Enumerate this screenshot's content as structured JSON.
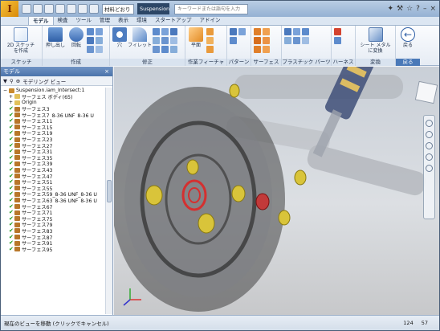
{
  "titlebar": {
    "material": "材料どおり",
    "document": "Suspension...",
    "search_placeholder": "キーワードまたは語句を入力"
  },
  "tabs": [
    "モデル",
    "検査",
    "ツール",
    "管理",
    "表示",
    "環境",
    "スタートアップ",
    "アドイン"
  ],
  "ribbon": {
    "sketch": {
      "create_2d": "2D スケッチ\nを作成",
      "label": "スケッチ"
    },
    "create": {
      "extrude": "押し出し",
      "revolve": "回転",
      "label": "作成"
    },
    "modify": {
      "hole": "穴",
      "fillet": "フィレット",
      "label": "修正"
    },
    "work_features": {
      "plane": "平面",
      "label": "作業フィーチャ"
    },
    "pattern": {
      "label": "パターン"
    },
    "surface": {
      "label": "サーフェス"
    },
    "plastic": {
      "label": "プラスチック パーツ"
    },
    "harness": {
      "label": "ハーネス"
    },
    "convert": {
      "sheet_metal": "シート メタル\nに変換",
      "label": "変換"
    },
    "return": {
      "back": "戻る",
      "label": "戻る"
    }
  },
  "browser": {
    "title": "モデル",
    "view_label": "モデリング ビュー",
    "items": [
      "Suspension.iam_Intersect:1",
      "サーフェス ボディ(65)",
      "Origin",
      "サーフェス3",
      "サーフェス7_8-36 UNF_8-36 U",
      "サーフェス11",
      "サーフェス15",
      "サーフェス19",
      "サーフェス23",
      "サーフェス27",
      "サーフェス31",
      "サーフェス35",
      "サーフェス39",
      "サーフェス43",
      "サーフェス47",
      "サーフェス51",
      "サーフェス55",
      "サーフェス59_8-36 UNF_8-36 U",
      "サーフェス63_8-36 UNF_8-36 U",
      "サーフェス67",
      "サーフェス71",
      "サーフェス75",
      "サーフェス79",
      "サーフェス83",
      "サーフェス87",
      "サーフェス91",
      "サーフェス95"
    ]
  },
  "status": {
    "message": "現在のビューを移動 (クリックでキャンセル)",
    "x": "124",
    "y": "57"
  },
  "colors": {
    "accent": "#4a79b8",
    "check": "#1c9a1c"
  }
}
